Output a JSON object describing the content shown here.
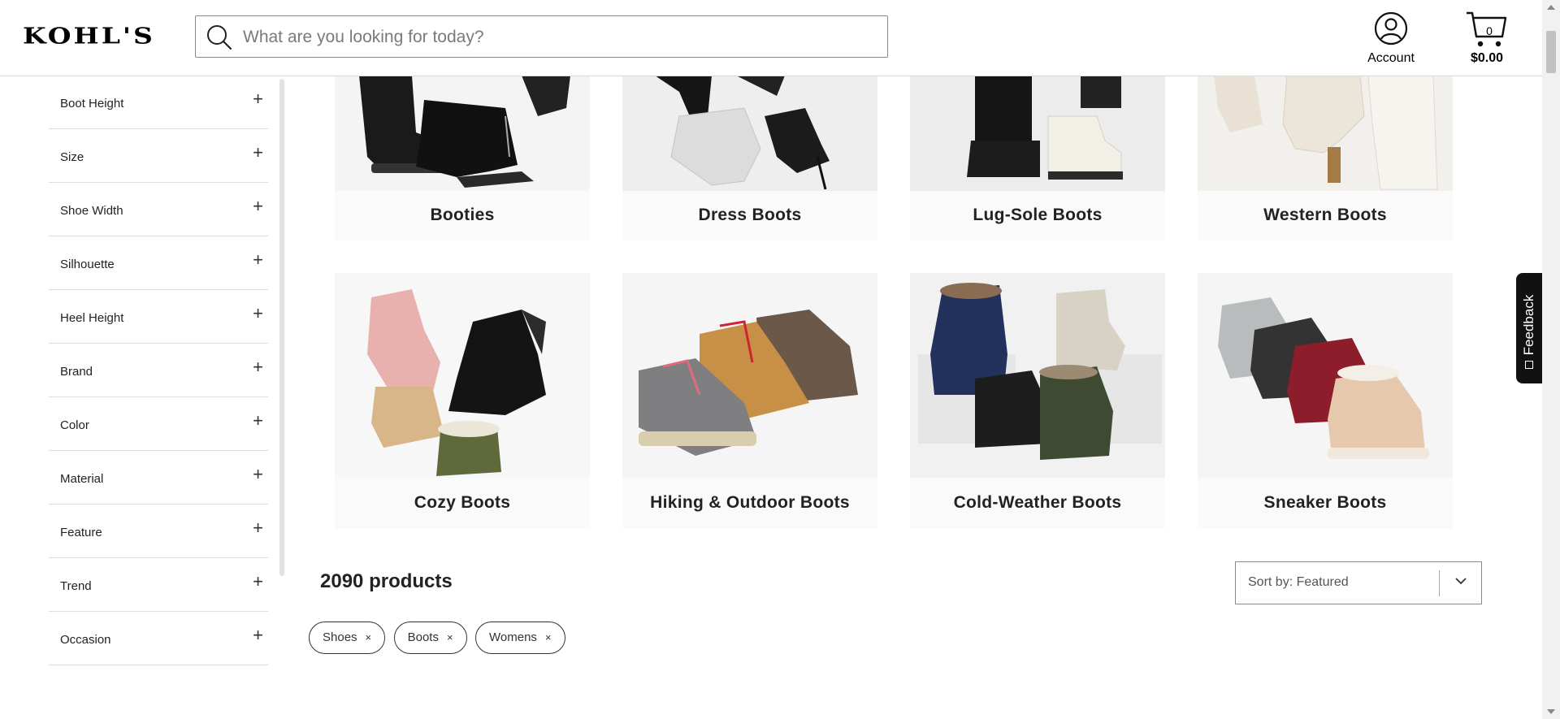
{
  "header": {
    "logo": "KOHL'S",
    "search_placeholder": "What are you looking for today?",
    "account_label": "Account",
    "cart_count": "0",
    "cart_total": "$0.00"
  },
  "filters": [
    {
      "label": "Boot Height"
    },
    {
      "label": "Size"
    },
    {
      "label": "Shoe Width"
    },
    {
      "label": "Silhouette"
    },
    {
      "label": "Heel Height"
    },
    {
      "label": "Brand"
    },
    {
      "label": "Color"
    },
    {
      "label": "Material"
    },
    {
      "label": "Feature"
    },
    {
      "label": "Trend"
    },
    {
      "label": "Occasion"
    }
  ],
  "categories": [
    {
      "name": "Booties"
    },
    {
      "name": "Dress Boots"
    },
    {
      "name": "Lug-Sole Boots"
    },
    {
      "name": "Western Boots"
    },
    {
      "name": "Cozy Boots"
    },
    {
      "name": "Hiking & Outdoor Boots"
    },
    {
      "name": "Cold-Weather Boots"
    },
    {
      "name": "Sneaker Boots"
    }
  ],
  "results": {
    "count": "2090",
    "count_suffix": "products",
    "sort_label": "Sort by: Featured"
  },
  "chips": [
    {
      "label": "Shoes",
      "remove": "×"
    },
    {
      "label": "Boots",
      "remove": "×"
    },
    {
      "label": "Womens",
      "remove": "×"
    }
  ],
  "feedback_label": "Feedback",
  "colors": {
    "brand": "#000000",
    "border": "#888888",
    "tile_bg": "#fafafa"
  }
}
